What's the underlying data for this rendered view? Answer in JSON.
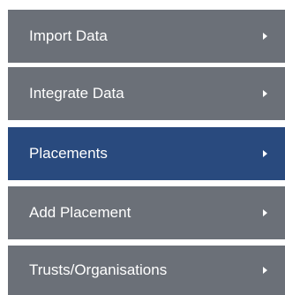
{
  "menu": {
    "items": [
      {
        "label": "Import Data",
        "active": false,
        "icon": "chevron-right-icon"
      },
      {
        "label": "Integrate Data",
        "active": false,
        "icon": "chevron-right-icon"
      },
      {
        "label": "Placements",
        "active": true,
        "icon": "chevron-right-icon"
      },
      {
        "label": "Add Placement",
        "active": false,
        "icon": "chevron-right-icon"
      },
      {
        "label": "Trusts/Organisations",
        "active": false,
        "icon": "chevron-right-icon"
      }
    ],
    "colors": {
      "inactive_bg": "#6b7078",
      "active_bg": "#294a7e",
      "text": "#ffffff"
    }
  }
}
